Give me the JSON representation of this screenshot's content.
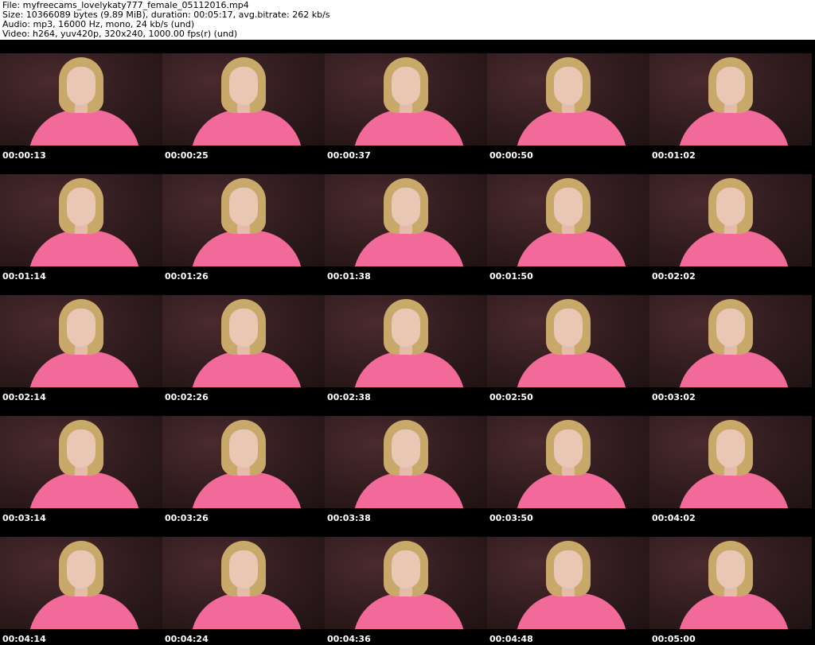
{
  "header": {
    "file": "File: myfreecams_lovelykaty777_female_05112016.mp4",
    "size": "Size: 10366089 bytes (9.89 MiB), duration: 00:05:17, avg.bitrate: 262 kb/s",
    "audio": "Audio: mp3, 16000 Hz, mono, 24 kb/s (und)",
    "video": "Video: h264, yuv420p, 320x240, 1000.00 fps(r) (und)"
  },
  "thumbnails": [
    "00:00:13",
    "00:00:25",
    "00:00:37",
    "00:00:50",
    "00:01:02",
    "00:01:14",
    "00:01:26",
    "00:01:38",
    "00:01:50",
    "00:02:02",
    "00:02:14",
    "00:02:26",
    "00:02:38",
    "00:02:50",
    "00:03:02",
    "00:03:14",
    "00:03:26",
    "00:03:38",
    "00:03:50",
    "00:04:02",
    "00:04:14",
    "00:04:24",
    "00:04:36",
    "00:04:48",
    "00:05:00"
  ],
  "colors": {
    "background": "#000000",
    "header_bg": "#ffffff",
    "shirt": "#f26a9a"
  }
}
